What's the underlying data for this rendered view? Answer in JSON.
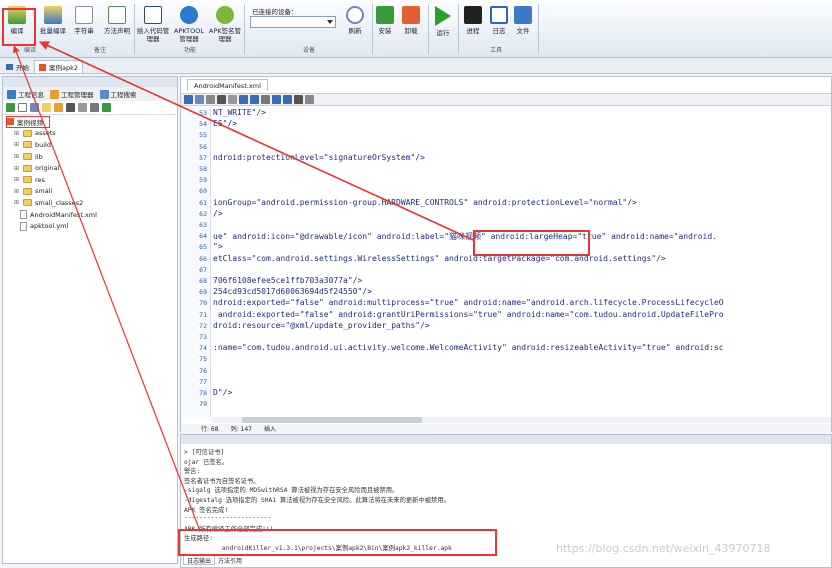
{
  "ribbon": {
    "buttons": [
      {
        "label": "编译",
        "icon": "compile-icon",
        "color": "#3a9a3a"
      },
      {
        "label": "批量编译",
        "icon": "batch-compile-icon",
        "color": "#3a7ac8"
      },
      {
        "label": "字符串",
        "icon": "string-icon",
        "color": "#8a8f99"
      },
      {
        "label": "方法声明",
        "icon": "method-icon",
        "color": "#5a8a5a"
      },
      {
        "label": "插入代码管理器",
        "icon": "code-manager-icon",
        "color": "#2a4a7a"
      },
      {
        "label": "APKTOOL管理器",
        "icon": "apktool-icon",
        "color": "#2a7ad0"
      },
      {
        "label": "APK签名管理器",
        "icon": "apk-sign-icon",
        "color": "#7ab83a"
      },
      {
        "label": "刷新",
        "icon": "refresh-icon",
        "color": "#6a8ab8"
      },
      {
        "label": "安装",
        "icon": "install-icon",
        "color": "#3a9a3a"
      },
      {
        "label": "卸载",
        "icon": "uninstall-icon",
        "color": "#e06030"
      },
      {
        "label": "运行",
        "icon": "run-icon",
        "color": "#2aa02a"
      },
      {
        "label": "进程",
        "icon": "process-icon",
        "color": "#222222"
      },
      {
        "label": "日志",
        "icon": "log-icon",
        "color": "#2a6ab8"
      },
      {
        "label": "文件",
        "icon": "file-icon",
        "color": "#3a7ac8"
      }
    ],
    "groups": [
      "编译",
      "备注",
      "功能",
      "设备",
      "工具"
    ],
    "device_label": "已连接的设备："
  },
  "tabs": {
    "home": "开始",
    "project": "案例apk2"
  },
  "left_panel": {
    "subtabs": [
      "工程信息",
      "工程管理器",
      "工程搜索"
    ],
    "root": "案例视频",
    "tree": [
      {
        "name": "assets",
        "kind": "folder"
      },
      {
        "name": "build",
        "kind": "folder"
      },
      {
        "name": "lib",
        "kind": "folder"
      },
      {
        "name": "original",
        "kind": "folder"
      },
      {
        "name": "res",
        "kind": "folder"
      },
      {
        "name": "smali",
        "kind": "folder"
      },
      {
        "name": "smali_classes2",
        "kind": "folder"
      },
      {
        "name": "AndroidManifest.xml",
        "kind": "file"
      },
      {
        "name": "apktool.yml",
        "kind": "file"
      }
    ]
  },
  "editor": {
    "tab": "AndroidManifest.xml",
    "lines": [
      {
        "n": "53",
        "text": "NT_WRITE\"/>"
      },
      {
        "n": "54",
        "text": "ES\"/>"
      },
      {
        "n": "55",
        "text": ""
      },
      {
        "n": "56",
        "text": ""
      },
      {
        "n": "57",
        "text": "ndroid:protectionLevel=\"signatureOrSystem\"/>"
      },
      {
        "n": "58",
        "text": ""
      },
      {
        "n": "59",
        "text": ""
      },
      {
        "n": "60",
        "text": ""
      },
      {
        "n": "61",
        "text": "ionGroup=\"android.permission-group.HARDWARE_CONTROLS\" android:protectionLevel=\"normal\"/>"
      },
      {
        "n": "62",
        "text": "/>"
      },
      {
        "n": "63",
        "text": ""
      },
      {
        "n": "64",
        "text": "ue\" android:icon=\"@drawable/icon\" android:label=\"猫咪视频\" android:largeHeap=\"true\" android:name=\"android."
      },
      {
        "n": "65",
        "text": "\">"
      },
      {
        "n": "66",
        "text": "etClass=\"com.android.settings.WirelessSettings\" android:targetPackage=\"com.android.settings\"/>"
      },
      {
        "n": "67",
        "text": ""
      },
      {
        "n": "68",
        "text": "706f6108efee5ce1ffb703a3077a\"/>"
      },
      {
        "n": "69",
        "text": "254cd93cd5017d60063694d5f24550\"/>"
      },
      {
        "n": "70",
        "text": "ndroid:exported=\"false\" android:multiprocess=\"true\" android:name=\"android.arch.lifecycle.ProcessLifecycleO"
      },
      {
        "n": "71",
        "text": " android:exported=\"false\" android:grantUriPermissions=\"true\" android:name=\"com.tudou.android.UpdateFilePro"
      },
      {
        "n": "72",
        "text": "droid:resource=\"@xml/update_provider_paths\"/>"
      },
      {
        "n": "73",
        "text": ""
      },
      {
        "n": "74",
        "text": ":name=\"com.tudou.android.ui.activity.welcome.WelcomeActivity\" android:resizeableActivity=\"true\" android:sc"
      },
      {
        "n": "75",
        "text": ""
      },
      {
        "n": "76",
        "text": ""
      },
      {
        "n": "77",
        "text": ""
      },
      {
        "n": "78",
        "text": "D\"/>"
      },
      {
        "n": "79",
        "text": ""
      }
    ],
    "status_row": "行: 68",
    "status_col": "列: 147",
    "status_mode": "插入"
  },
  "output": {
    "lines": [
      "> [可信证书]",
      "ojar 已签名。",
      "警告:",
      "签名者证书为自签名证书。",
      "-sigalg 选项指定的 MD5withRSA 算法被视为存在安全风险而且被禁用。",
      "-digestalg 选项指定的 SHA1 算法被视为存在安全风险。此算法将在未来的更新中被禁用。",
      "APK 签名完成!",
      "-----------------------",
      "APK 所有编译工作全部完成!!!",
      "生成路径:",
      "          androidKiller_v1.3.1\\projects\\案例apk2\\Bin\\案例apk2_killer.apk"
    ],
    "tabs": [
      "日志输出",
      "方法引用"
    ]
  },
  "watermark": "https://blog.csdn.net/weixin_43970718"
}
